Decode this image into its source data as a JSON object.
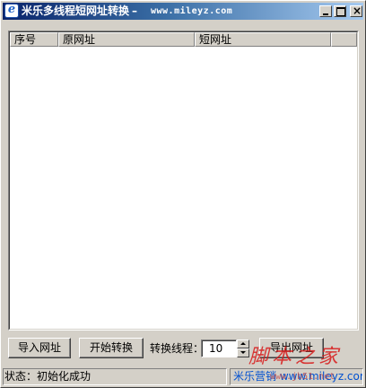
{
  "window": {
    "title": "米乐多线程短网址转换",
    "title_separator": "–",
    "title_url": "www.mileyz.com",
    "app_icon_glyph": "e"
  },
  "titlebar_buttons": {
    "close_glyph": "×"
  },
  "list": {
    "columns": [
      "序号",
      "原网址",
      "短网址",
      ""
    ],
    "rows": []
  },
  "toolbar": {
    "import_label": "导入网址",
    "start_label": "开始转换",
    "thread_label": "转换线程：",
    "thread_value": "10",
    "export_label": "导出网址"
  },
  "status": {
    "text": "状态：初始化成功",
    "link": "米乐营销 www.mileyz.com"
  },
  "watermark": {
    "main": "脚本之家",
    "url": "www.jb51.net"
  },
  "colors": {
    "title_start": "#0a246a",
    "title_end": "#a6caf0",
    "face": "#d4d0c8",
    "link": "#0050d0",
    "watermark": "#d81b1b"
  }
}
